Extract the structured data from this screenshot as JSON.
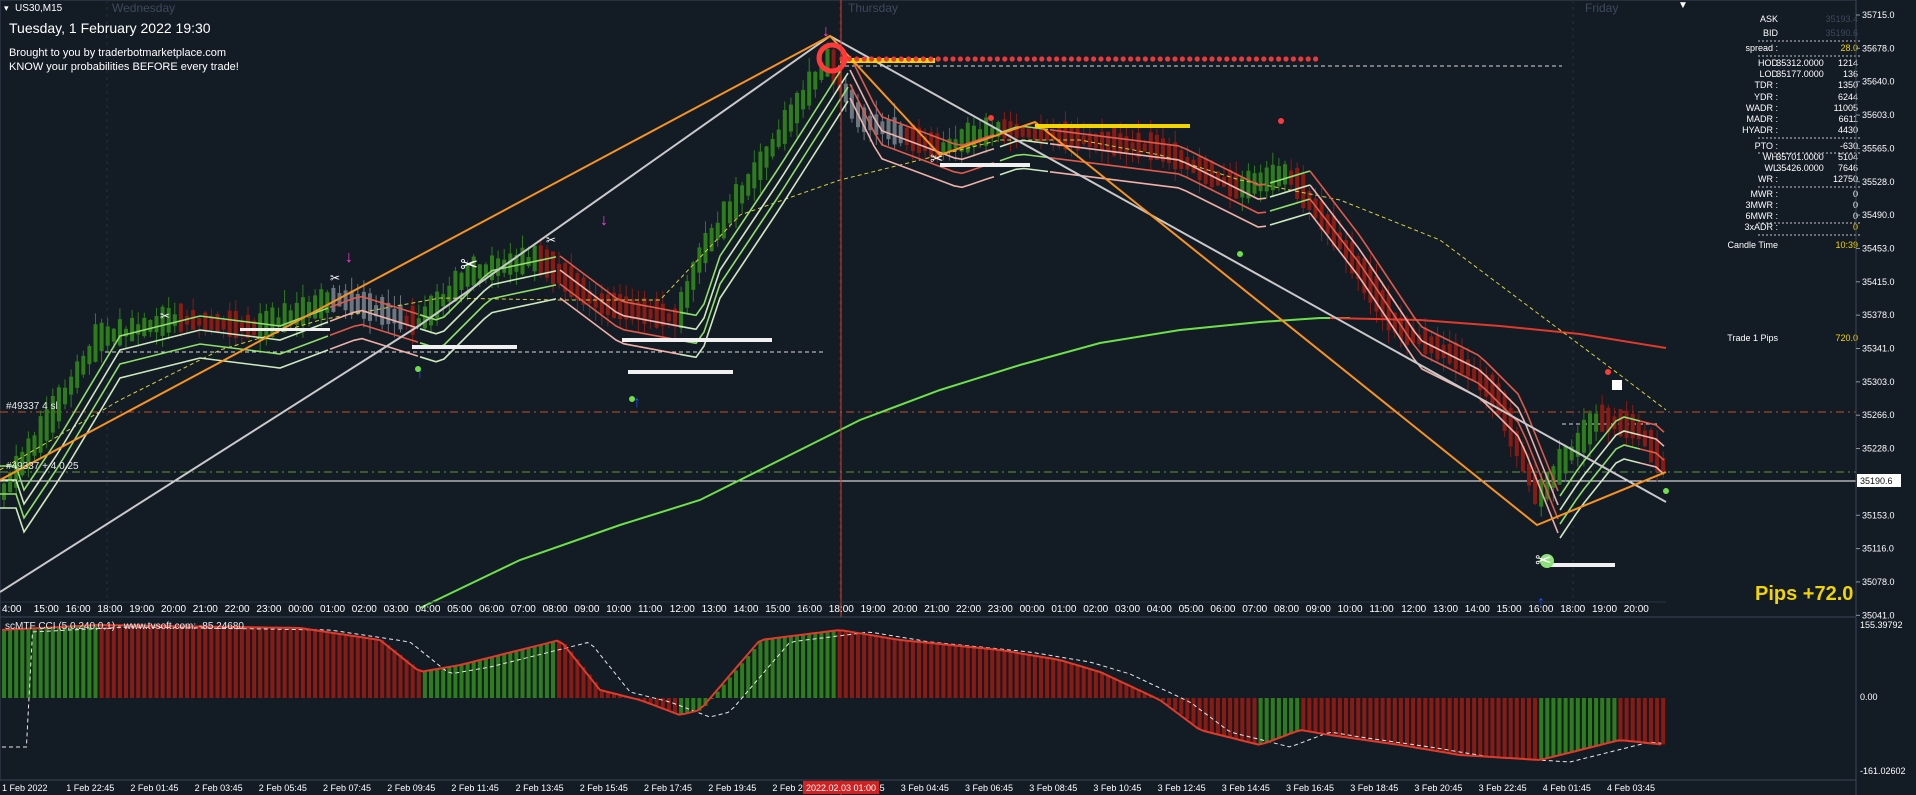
{
  "window": {
    "symbol_timeframe": "US30,M15",
    "datetime": "Tuesday, 1 February 2022 19:30",
    "promo_line1": "Brought to you by traderbotmarketplace.com",
    "promo_line2": "KNOW your probabilities BEFORE every trade!"
  },
  "day_labels": [
    "Wednesday",
    "Thursday",
    "Friday"
  ],
  "price_axis": [
    "35715.0",
    "35678.0",
    "35640.0",
    "35603.0",
    "35565.0",
    "35528.0",
    "35490.0",
    "35453.0",
    "35415.0",
    "35378.0",
    "35341.0",
    "35303.0",
    "35266.0",
    "35228.0",
    "35190.6",
    "35153.0",
    "35116.0",
    "35078.0",
    "35041.0"
  ],
  "current_price": "35190.6",
  "time_axis_main": [
    "4:00",
    "15:00",
    "16:00",
    "18:00",
    "19:00",
    "20:00",
    "21:00",
    "22:00",
    "23:00",
    "00:00",
    "01:00",
    "02:00",
    "03:00",
    "04:00",
    "05:00",
    "06:00",
    "07:00",
    "08:00",
    "09:00",
    "10:00",
    "11:00",
    "12:00",
    "13:00",
    "14:00",
    "15:00",
    "16:00",
    "18:00",
    "19:00",
    "20:00",
    "21:00",
    "22:00",
    "23:00",
    "00:00",
    "01:00",
    "02:00",
    "03:00",
    "04:00",
    "05:00",
    "06:00",
    "07:00",
    "08:00",
    "09:00",
    "10:00",
    "11:00",
    "12:00",
    "13:00",
    "14:00",
    "15:00",
    "16:00",
    "18:00",
    "19:00",
    "20:00"
  ],
  "time_axis_bottom": [
    "1 Feb 2022",
    "1 Feb 22:45",
    "2 Feb 01:45",
    "2 Feb 03:45",
    "2 Feb 05:45",
    "2 Feb 07:45",
    "2 Feb 09:45",
    "2 Feb 11:45",
    "2 Feb 13:45",
    "2 Feb 15:45",
    "2 Feb 17:45",
    "2 Feb 19:45",
    "2 Feb 2",
    "3 Feb 02:45",
    "3 Feb 04:45",
    "3 Feb 06:45",
    "3 Feb 08:45",
    "3 Feb 10:45",
    "3 Feb 12:45",
    "3 Feb 14:45",
    "3 Feb 16:45",
    "3 Feb 18:45",
    "3 Feb 20:45",
    "3 Feb 22:45",
    "4 Feb 01:45",
    "4 Feb 03:45"
  ],
  "crosshair_time": "2022.02.03 01:00",
  "stats": {
    "ask_label": "ASK",
    "ask_value": "35193.4",
    "bid_label": "BID",
    "bid_value": "35190.6",
    "spread_label": "spread :",
    "spread_value": "28.0",
    "hod_label": "HOD",
    "hod_price": "35312.0000",
    "hod_value": "1214",
    "lod_label": "LOD",
    "lod_price": "35177.0000",
    "lod_value": "136",
    "tdr_label": "TDR :",
    "tdr_value": "1350",
    "ydr_label": "YDR :",
    "ydr_value": "6244",
    "wadr_label": "WADR :",
    "wadr_value": "11005",
    "madr_label": "MADR :",
    "madr_value": "6611",
    "hyadr_label": "HYADR :",
    "hyadr_value": "4430",
    "pto_label": "PTO :",
    "pto_value": "-630",
    "wh_label": "WH",
    "wh_price": "35701.0000",
    "wh_value": "5104",
    "wl_label": "WL",
    "wl_price": "35426.0000",
    "wl_value": "7646",
    "wr_label": "WR :",
    "wr_value": "12750",
    "mwr_label": "MWR :",
    "mwr_value": "0",
    "mwr3_label": "3MWR :",
    "mwr3_value": "0",
    "mwr6_label": "6MWR :",
    "mwr6_value": "0",
    "adr3_label": "3xADR :",
    "adr3_value": "0",
    "candle_label": "Candle Time",
    "candle_value": "10:39",
    "trade_label": "Trade 1 Pips",
    "trade_value": "720.0"
  },
  "pips_banner": "Pips +72.0",
  "order_label_1": "#49337  4 sl",
  "order_label_2": "#49337  + 4 0.25",
  "indicator": {
    "title": "scMTF CCI (5,0,240,0,1) - www.tvsoft.com: -85.24680",
    "axis_top": "155.39792",
    "axis_zero": "0.00",
    "axis_bottom": "-161.02602"
  },
  "colors": {
    "background": "#131b25",
    "bull": "#2e7d1c",
    "bear": "#8b1a12",
    "orange": "#f7931e",
    "ma_green": "#6ee04a",
    "ma_red": "#e03a2a",
    "accent_yellow": "#f2d400"
  }
}
